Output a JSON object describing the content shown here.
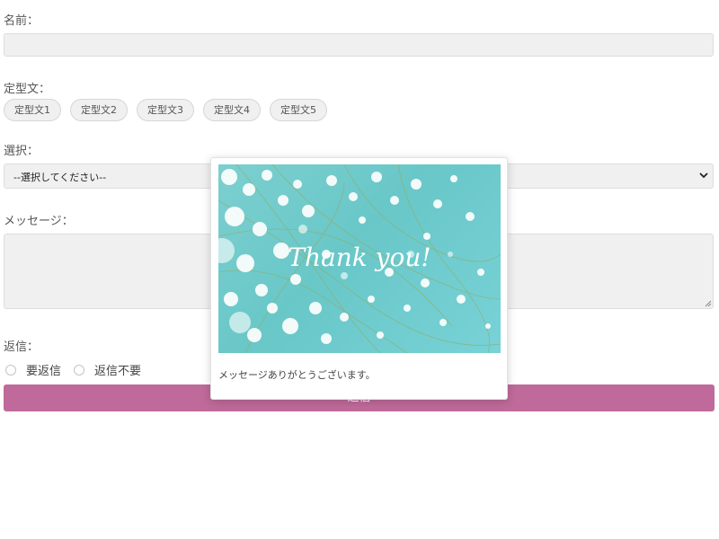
{
  "form": {
    "name_label": "名前：",
    "template_label": "定型文：",
    "templates": [
      "定型文1",
      "定型文2",
      "定型文3",
      "定型文4",
      "定型文5"
    ],
    "select_label": "選択：",
    "select_value": "--選択してください--",
    "message_label": "メッセージ：",
    "reply_label": "返信：",
    "reply_options": [
      "要返信",
      "返信不要"
    ],
    "submit_label": "送信"
  },
  "modal": {
    "image_text": "Thank you!",
    "message": "メッセージありがとうございます。"
  },
  "colors": {
    "accent": "#bf6a9a",
    "field_bg": "#f0f0f0",
    "image_bg": "#6fc9cb"
  }
}
